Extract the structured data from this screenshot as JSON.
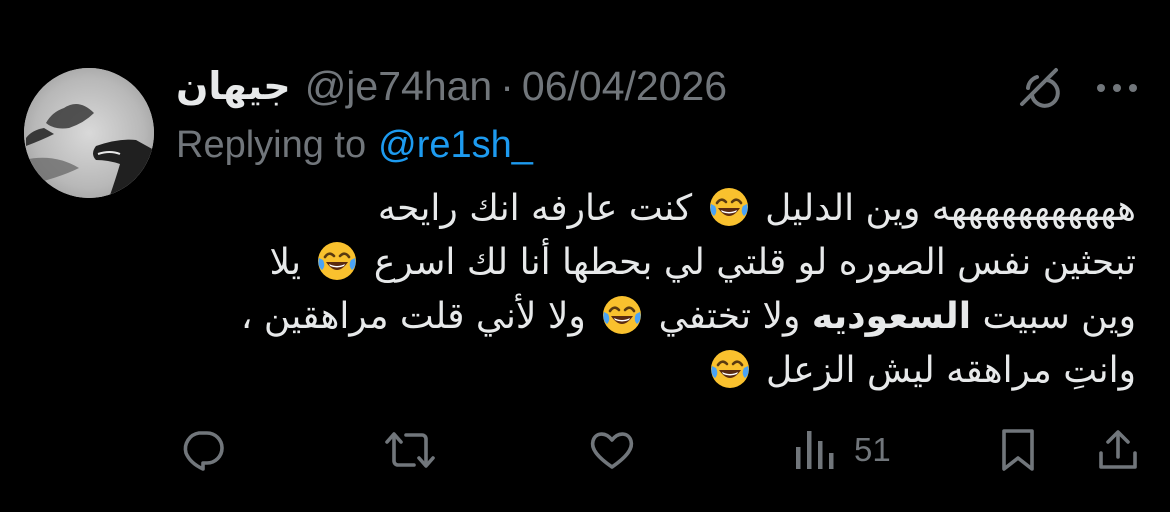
{
  "colors": {
    "background": "#000000",
    "primary_text": "#e7e9ea",
    "secondary_text": "#71767b",
    "link": "#1d9bf0",
    "emoji_yellow": "#f9c12e",
    "tear_blue": "#4aa3f5"
  },
  "tweet": {
    "author": {
      "display_name": "جيهان",
      "handle": "@je74han",
      "avatar_icon": "avatar-image"
    },
    "separator": "·",
    "date": "06/04/2026",
    "reply": {
      "prefix": "Replying to",
      "mention": "@re1sh_"
    },
    "header_icons": [
      "grok-icon",
      "more-options-icon"
    ],
    "body": {
      "line1": {
        "a": "هههههههههههه وين الدليل",
        "b": "كنت عارفه انك رايحه"
      },
      "line2": {
        "a": "تبحثين نفس الصوره لو قلتي لي بحطها أنا لك اسرع",
        "b": "يلا"
      },
      "line3": {
        "a": "وين سبيت",
        "bold": "السعوديه",
        "b": "ولا تختفي",
        "c": "ولا لأني قلت مراهقين ،"
      },
      "line4": {
        "a": "وانتِ مراهقه ليش الزعل"
      },
      "emoji": "face-with-tears-of-joy"
    },
    "actions": {
      "icons": [
        "reply-icon",
        "retweet-icon",
        "like-icon",
        "views-icon",
        "bookmark-icon",
        "share-icon"
      ],
      "views_count": "51"
    }
  }
}
